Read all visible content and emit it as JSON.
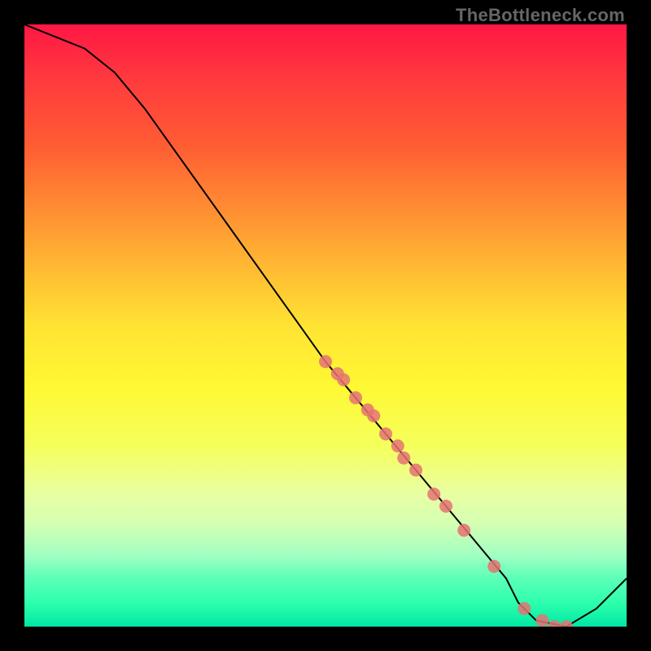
{
  "watermark": "TheBottleneck.com",
  "chart_data": {
    "type": "line",
    "title": "",
    "xlabel": "",
    "ylabel": "",
    "xlim": [
      0,
      100
    ],
    "ylim": [
      0,
      100
    ],
    "curve": {
      "x": [
        0,
        5,
        10,
        15,
        20,
        25,
        30,
        35,
        40,
        45,
        50,
        55,
        60,
        65,
        70,
        75,
        80,
        82,
        85,
        90,
        95,
        100
      ],
      "y": [
        100,
        98,
        96,
        92,
        86,
        79,
        72,
        65,
        58,
        51,
        44,
        38,
        32,
        26,
        20,
        14,
        8,
        4,
        1,
        0,
        3,
        8
      ]
    },
    "markers": {
      "x": [
        50,
        52,
        53,
        55,
        57,
        58,
        60,
        62,
        63,
        65,
        68,
        70,
        73,
        78,
        83,
        86,
        88,
        90
      ],
      "y": [
        44,
        42,
        41,
        38,
        36,
        35,
        32,
        30,
        28,
        26,
        22,
        20,
        16,
        10,
        3,
        1,
        0,
        0
      ]
    },
    "marker_color": "#e57373",
    "line_color": "#000000"
  }
}
